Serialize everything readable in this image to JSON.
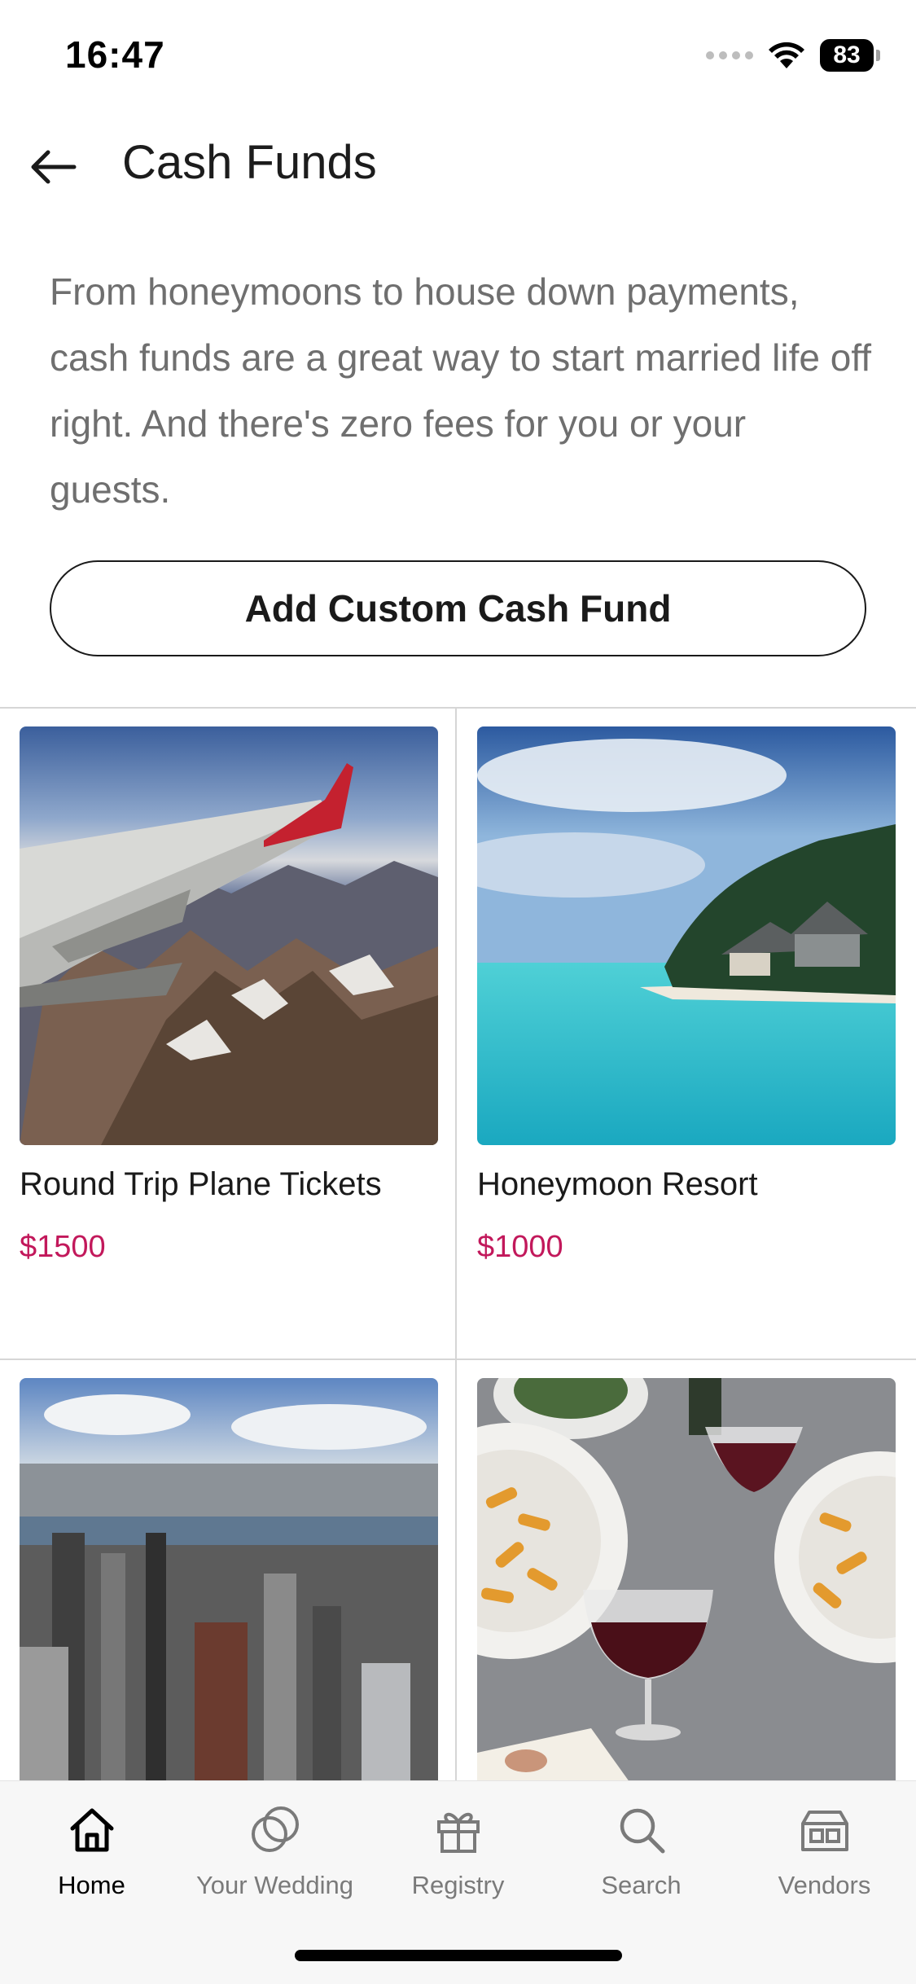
{
  "status_bar": {
    "time": "16:47",
    "battery": "83"
  },
  "header": {
    "title": "Cash Funds",
    "back_icon": "arrow-left-icon"
  },
  "intro_text": "From honeymoons to house down payments, cash funds are a great way to start married life off right. And there's zero fees for you or your guests.",
  "add_button_label": "Add Custom Cash Fund",
  "funds": [
    {
      "name": "Round Trip Plane Tickets",
      "price": "$1500",
      "image": "airplane-wing-over-mountains"
    },
    {
      "name": "Honeymoon Resort",
      "price": "$1000",
      "image": "tropical-beach-resort"
    },
    {
      "name": "",
      "price": "",
      "image": "city-skyline-aerial"
    },
    {
      "name": "",
      "price": "",
      "image": "pasta-and-red-wine-dinner"
    }
  ],
  "tabs": [
    {
      "label": "Home",
      "icon": "home-icon",
      "active": true
    },
    {
      "label": "Your Wedding",
      "icon": "rings-icon",
      "active": false
    },
    {
      "label": "Registry",
      "icon": "gift-icon",
      "active": false
    },
    {
      "label": "Search",
      "icon": "search-icon",
      "active": false
    },
    {
      "label": "Vendors",
      "icon": "vendors-icon",
      "active": false
    }
  ],
  "colors": {
    "price": "#c2185b",
    "accent": "#000000",
    "muted_text": "#6f6f6f"
  }
}
